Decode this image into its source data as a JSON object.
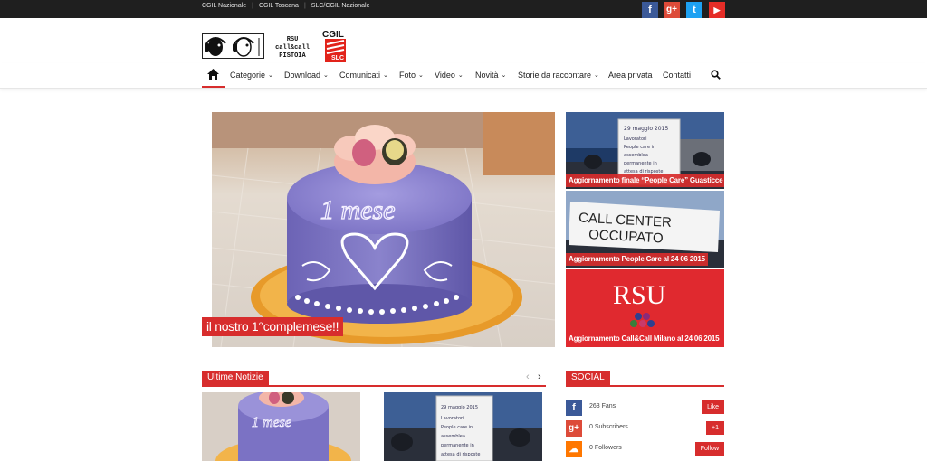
{
  "topbar": {
    "links": [
      "CGIL Nazionale",
      "CGIL Toscana",
      "SLC/CGIL Nazionale"
    ],
    "social": [
      {
        "icon": "facebook-icon",
        "glyph": "f",
        "color": "#3b5998"
      },
      {
        "icon": "googleplus-icon",
        "glyph": "g+",
        "color": "#dd4b39"
      },
      {
        "icon": "twitter-icon",
        "glyph": "t",
        "color": "#1da1f2"
      },
      {
        "icon": "youtube-icon",
        "glyph": "▶",
        "color": "#e52d27"
      }
    ]
  },
  "header": {
    "logo_text_lines": [
      "RSU",
      "call&call",
      "PISTOIA"
    ],
    "cgil_logo_text": "CGIL",
    "slc_text": "SLC"
  },
  "nav": {
    "home_icon": "home-icon",
    "items": [
      {
        "label": "Categorie",
        "dropdown": true
      },
      {
        "label": "Download",
        "dropdown": true
      },
      {
        "label": "Comunicati",
        "dropdown": true
      },
      {
        "label": "Foto",
        "dropdown": true
      },
      {
        "label": "Video",
        "dropdown": true
      },
      {
        "label": "Novità",
        "dropdown": true
      },
      {
        "label": "Storie da raccontare",
        "dropdown": true
      },
      {
        "label": "Area privata",
        "dropdown": false
      },
      {
        "label": "Contatti",
        "dropdown": false
      }
    ],
    "search_icon": "search-icon"
  },
  "hero": {
    "caption": "il nostro 1°complemese!!",
    "cake_text": "1 mese"
  },
  "side_cards": [
    {
      "caption": "Aggiornamento finale “People Care” Guasticce",
      "sign_lines": [
        "29 maggio 2015",
        "Lavoratori",
        "People care in",
        "assemblea",
        "permanente in",
        "attesa di risposte"
      ]
    },
    {
      "caption": "Aggiornamento People Care al 24 06 2015",
      "banner_lines": [
        "CALL CENTER",
        "OCCUPATO"
      ]
    },
    {
      "caption": "Aggiornamento Call&Call Milano al 24 06 2015",
      "rsu_text": "RSU"
    }
  ],
  "news": {
    "title": "Ultime Notizie",
    "prev_icon": "chevron-left-icon",
    "next_icon": "chevron-right-icon"
  },
  "social": {
    "title": "SOCIAL",
    "rows": [
      {
        "icon": "facebook-icon",
        "glyph": "f",
        "color": "#3b5998",
        "count": "263 Fans",
        "button": "Like"
      },
      {
        "icon": "googleplus-icon",
        "glyph": "g+",
        "color": "#dd4b39",
        "count": "0 Subscribers",
        "button": "+1"
      },
      {
        "icon": "soundcloud-icon",
        "glyph": "☁",
        "color": "#ff7700",
        "count": "0 Followers",
        "button": "Follow"
      }
    ]
  }
}
